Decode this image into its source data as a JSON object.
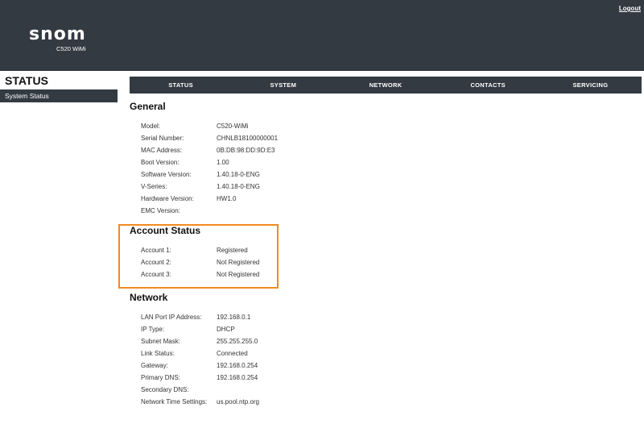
{
  "header": {
    "logout_label": "Logout",
    "logo_text": "snom",
    "model_label": "C520 WiMi"
  },
  "sidebar": {
    "title": "STATUS",
    "items": [
      {
        "label": "System Status"
      }
    ]
  },
  "nav": {
    "items": [
      {
        "label": "STATUS"
      },
      {
        "label": "SYSTEM"
      },
      {
        "label": "NETWORK"
      },
      {
        "label": "CONTACTS"
      },
      {
        "label": "SERVICING"
      }
    ]
  },
  "general": {
    "title": "General",
    "rows": [
      {
        "label": "Model:",
        "value": "C520-WiMi"
      },
      {
        "label": "Serial Number:",
        "value": "CHNLB18100000001"
      },
      {
        "label": "MAC Address:",
        "value": "0B:DB:98:DD:9D:E3"
      },
      {
        "label": "Boot Version:",
        "value": "1.00"
      },
      {
        "label": "Software Version:",
        "value": "1.40.18-0-ENG"
      },
      {
        "label": "V-Series:",
        "value": "1.40.18-0-ENG"
      },
      {
        "label": "Hardware Version:",
        "value": "HW1.0"
      },
      {
        "label": "EMC Version:",
        "value": ""
      }
    ]
  },
  "account_status": {
    "title": "Account Status",
    "rows": [
      {
        "label": "Account 1:",
        "value": "Registered"
      },
      {
        "label": "Account 2:",
        "value": "Not Registered"
      },
      {
        "label": "Account 3:",
        "value": "Not Registered"
      }
    ]
  },
  "network": {
    "title": "Network",
    "rows": [
      {
        "label": "LAN Port IP Address:",
        "value": "192.168.0.1"
      },
      {
        "label": "IP Type:",
        "value": "DHCP"
      },
      {
        "label": "Subnet Mask:",
        "value": "255.255.255.0"
      },
      {
        "label": "Link Status:",
        "value": "Connected"
      },
      {
        "label": "Gateway:",
        "value": "192.168.0.254"
      },
      {
        "label": "Primary DNS:",
        "value": "192.168.0.254"
      },
      {
        "label": "Secondary DNS:",
        "value": ""
      },
      {
        "label": "Network Time Settings:",
        "value": "us.pool.ntp.org"
      }
    ]
  },
  "colors": {
    "header_bg": "#333a42",
    "highlight": "#f28a1e"
  }
}
